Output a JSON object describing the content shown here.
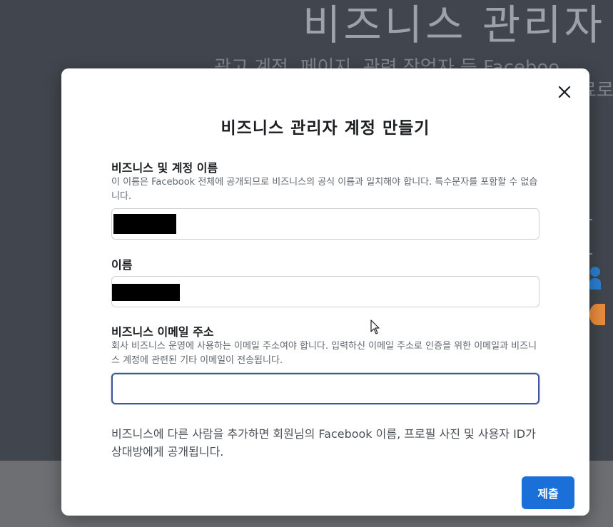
{
  "background": {
    "hero_title": "비즈니스 관리자",
    "hero_subtitle": "광고 계정, 페이지, 관련 작업자 등 Faceboo",
    "hero_subtitle_2": "료로"
  },
  "modal": {
    "title": "비즈니스 관리자 계정 만들기",
    "close_icon": "close-icon",
    "fields": {
      "business_name": {
        "label": "비즈니스 및 계정 이름",
        "help": "이 이름은 Facebook 전체에 공개되므로 비즈니스의 공식 이름과 일치해야 합니다. 특수문자를 포함할 수 없습니다.",
        "value": ""
      },
      "name": {
        "label": "이름",
        "value": ""
      },
      "business_email": {
        "label": "비즈니스 이메일 주소",
        "help": "회사 비즈니스 운영에 사용하는 이메일 주소여야 합니다. 입력하신 이메일 주소로 인증을 위한 이메일과 비즈니스 계정에 관련된 기타 이메일이 전송됩니다.",
        "value": "",
        "placeholder": ""
      }
    },
    "notice": "비즈니스에 다른 사람을 추가하면 회원님의 Facebook 이름, 프로필 사진 및 사용자 ID가 상대방에게 공개됩니다.",
    "submit_label": "제출"
  },
  "colors": {
    "accent": "#1a6fd8",
    "focus_border": "#3b5998",
    "overlay": "#41454d"
  }
}
